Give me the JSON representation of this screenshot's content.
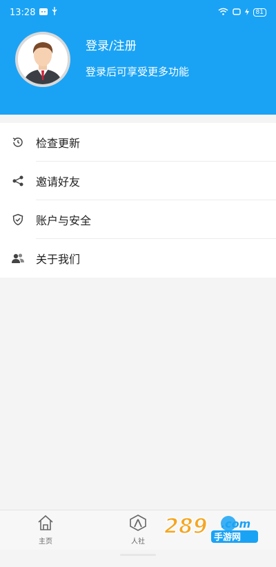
{
  "status_bar": {
    "time": "13:28",
    "battery": "81"
  },
  "profile": {
    "title": "登录/注册",
    "subtitle": "登录后可享受更多功能"
  },
  "menu": [
    {
      "label": "检查更新",
      "icon": "clock-icon"
    },
    {
      "label": "邀请好友",
      "icon": "share-icon"
    },
    {
      "label": "账户与安全",
      "icon": "shield-icon"
    },
    {
      "label": "关于我们",
      "icon": "users-icon"
    }
  ],
  "tabs": [
    {
      "label": "主页",
      "icon": "home-icon"
    },
    {
      "label": "人社",
      "icon": "person-icon"
    }
  ],
  "watermark": {
    "text": "289.com 手游网"
  },
  "colors": {
    "header_blue": "#1aa3f5",
    "watermark_orange": "#f5a623"
  }
}
